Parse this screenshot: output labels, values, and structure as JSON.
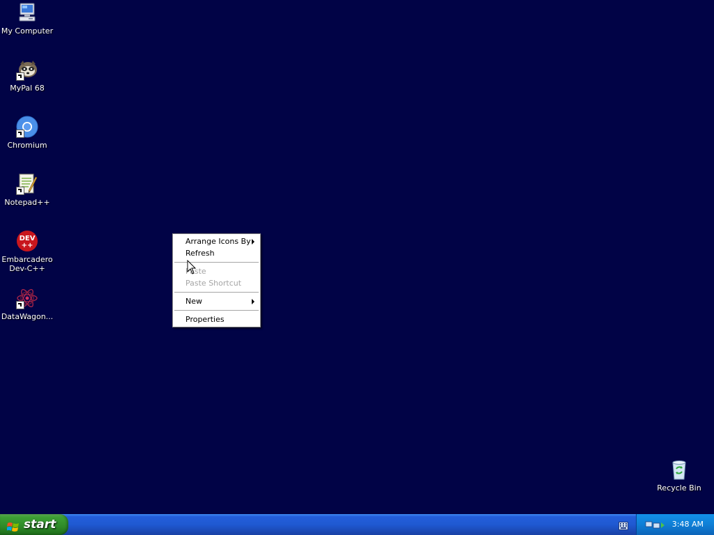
{
  "desktop": {
    "icons": [
      {
        "label": "My Computer",
        "icon": "my-computer-icon"
      },
      {
        "label": "MyPal 68",
        "icon": "mypal-icon"
      },
      {
        "label": "Chromium",
        "icon": "chromium-icon"
      },
      {
        "label": "Notepad++",
        "icon": "notepad-plus-plus-icon"
      },
      {
        "label": "Embarcadero Dev-C++",
        "icon": "dev-cpp-icon"
      },
      {
        "label": "DataWagon...",
        "icon": "datawagon-icon"
      },
      {
        "label": "Recycle Bin",
        "icon": "recycle-bin-icon"
      }
    ],
    "background_color": "#010346"
  },
  "context_menu": {
    "items": [
      {
        "label": "Arrange Icons By",
        "submenu": true,
        "enabled": true
      },
      {
        "label": "Refresh",
        "submenu": false,
        "enabled": true
      },
      {
        "label": "Paste",
        "submenu": false,
        "enabled": false
      },
      {
        "label": "Paste Shortcut",
        "submenu": false,
        "enabled": false
      },
      {
        "label": "New",
        "submenu": true,
        "enabled": true
      },
      {
        "label": "Properties",
        "submenu": false,
        "enabled": true
      }
    ]
  },
  "taskbar": {
    "start_label": "start",
    "clock": "3:48 AM"
  }
}
